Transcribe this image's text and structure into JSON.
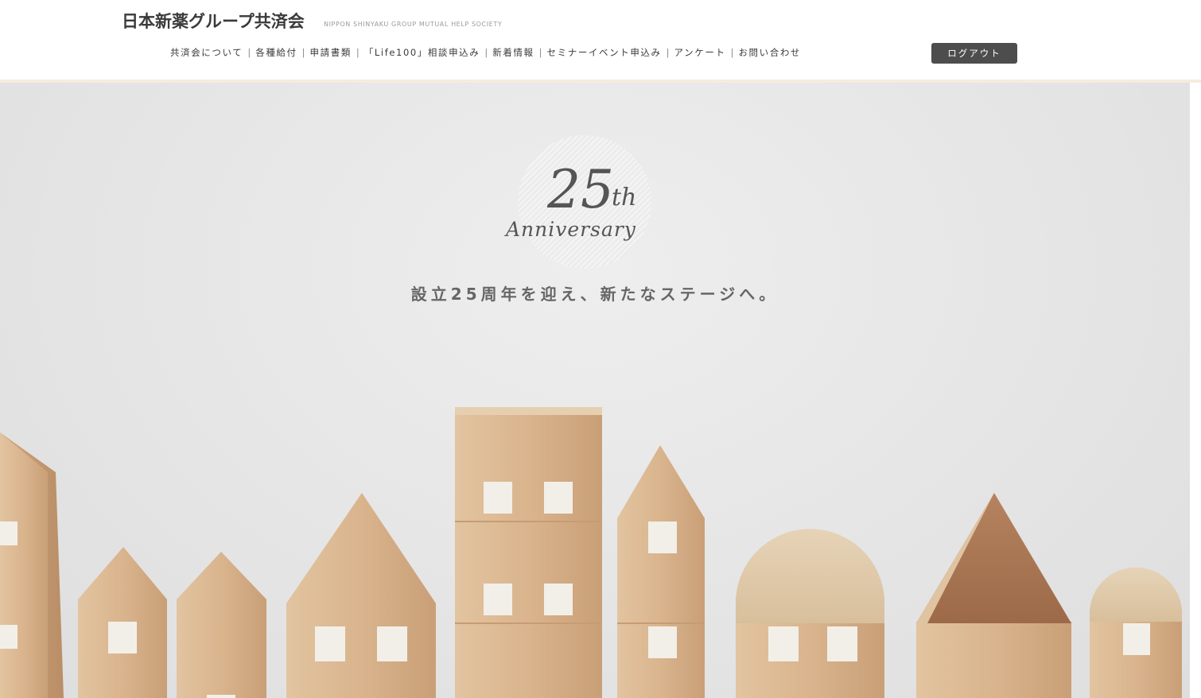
{
  "site": {
    "title": "日本新薬グループ共済会",
    "subtitle": "NIPPON SHINYAKU GROUP MUTUAL HELP SOCIETY"
  },
  "nav": {
    "items": [
      {
        "label": "共済会について"
      },
      {
        "label": "各種給付"
      },
      {
        "label": "申請書類"
      },
      {
        "label": "「Life100」相談申込み"
      },
      {
        "label": "新着情報"
      },
      {
        "label": "セミナーイベント申込み"
      },
      {
        "label": "アンケート"
      },
      {
        "label": "お問い合わせ"
      }
    ],
    "separator": "|",
    "logout_label": "ログアウト"
  },
  "hero": {
    "number": "25",
    "suffix": "th",
    "word": "Anniversary",
    "tagline": "設立25周年を迎え、新たなステージへ。"
  },
  "colors": {
    "logout_bg": "#4d4d4d",
    "hero_bg": "#e6e6e6",
    "wood": "#d8b48e",
    "header_accent": "#f6ecdd"
  }
}
